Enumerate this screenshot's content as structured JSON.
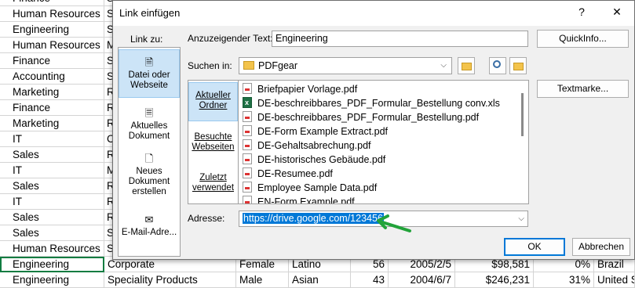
{
  "sheet": {
    "rows": [
      {
        "a": "Finance",
        "b": "S"
      },
      {
        "a": "Human Resources",
        "b": "S"
      },
      {
        "a": "Engineering",
        "b": "S"
      },
      {
        "a": "Human Resources",
        "b": "M"
      },
      {
        "a": "Finance",
        "b": "S"
      },
      {
        "a": "Accounting",
        "b": "S"
      },
      {
        "a": "Marketing",
        "b": "R"
      },
      {
        "a": "Finance",
        "b": "R"
      },
      {
        "a": "Marketing",
        "b": "R"
      },
      {
        "a": "IT",
        "b": "C"
      },
      {
        "a": "Sales",
        "b": "R"
      },
      {
        "a": "IT",
        "b": "M"
      },
      {
        "a": "Sales",
        "b": "R"
      },
      {
        "a": "IT",
        "b": "R"
      },
      {
        "a": "Sales",
        "b": "R"
      },
      {
        "a": "Sales",
        "b": "S"
      },
      {
        "a": "Human Resources",
        "b": "S"
      }
    ],
    "selected_row": {
      "a": "Engineering",
      "b": "Corporate",
      "c": "Female",
      "d": "Latino",
      "e": "56",
      "f": "2005/2/5",
      "g": "$98,581",
      "h": "0%",
      "i": "Brazil"
    },
    "partial_row": {
      "a": "Engineering",
      "b": "Speciality Products",
      "c": "Male",
      "d": "Asian",
      "e": "43",
      "f": "2004/6/7",
      "g": "$246,231",
      "h": "31%",
      "i": "United S"
    }
  },
  "dialog": {
    "title": "Link einfügen",
    "help_label": "?",
    "close_label": "✕",
    "link_to_label": "Link zu:",
    "nav_items": [
      {
        "label": "Datei oder Webseite",
        "active": true
      },
      {
        "label": "Aktuelles Dokument",
        "active": false
      },
      {
        "label": "Neues Dokument erstellen",
        "active": false
      },
      {
        "label": "E-Mail-Adre...",
        "active": false
      }
    ],
    "display_text_label": "Anzuzeigender Text:",
    "display_text_value": "Engineering",
    "quickinfo_label": "QuickInfo...",
    "search_in_label": "Suchen in:",
    "search_in_value": "PDFgear",
    "side_items": [
      {
        "label": "Aktueller Ordner",
        "active": true
      },
      {
        "label": "Besuchte Webseiten",
        "active": false
      },
      {
        "label": "Zuletzt verwendet",
        "active": false
      }
    ],
    "files": [
      {
        "name": "Briefpapier Vorlage.pdf",
        "type": "pdf"
      },
      {
        "name": "DE-beschreibbares_PDF_Formular_Bestellung conv.xls",
        "type": "xls"
      },
      {
        "name": "DE-beschreibbares_PDF_Formular_Bestellung.pdf",
        "type": "pdf"
      },
      {
        "name": "DE-Form Example Extract.pdf",
        "type": "pdf"
      },
      {
        "name": "DE-Gehaltsabrechung.pdf",
        "type": "pdf"
      },
      {
        "name": "DE-historisches Gebäude.pdf",
        "type": "pdf"
      },
      {
        "name": "DE-Resumee.pdf",
        "type": "pdf"
      },
      {
        "name": "Employee Sample Data.pdf",
        "type": "pdf"
      },
      {
        "name": "EN-Form Example.pdf",
        "type": "pdf"
      }
    ],
    "textmarke_label": "Textmarke...",
    "address_label": "Adresse:",
    "address_value": "https://drive.google.com/123456",
    "ok_label": "OK",
    "cancel_label": "Abbrechen",
    "colors": {
      "selection": "#0078d7",
      "arrow": "#22a33a",
      "excel_green": "#107c41"
    }
  }
}
